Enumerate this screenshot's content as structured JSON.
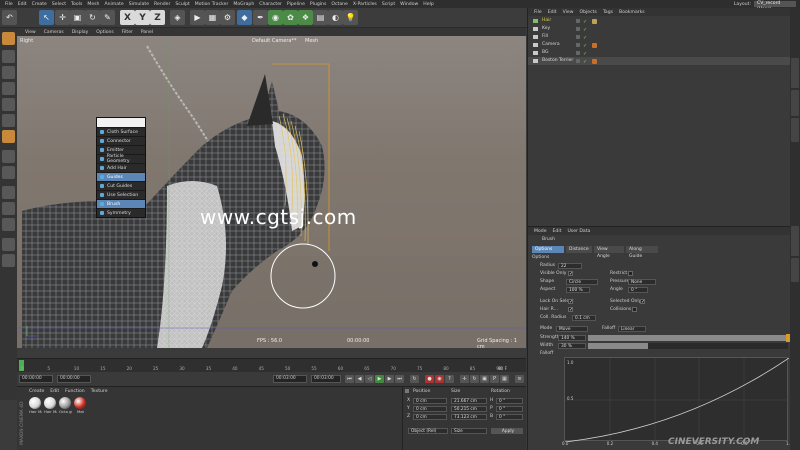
{
  "menubar": {
    "items": [
      "File",
      "Edit",
      "Create",
      "Select",
      "Tools",
      "Mesh",
      "Animate",
      "Simulate",
      "Render",
      "Sculpt",
      "Motion Tracker",
      "MoGraph",
      "Character",
      "Pipeline",
      "Plugins",
      "Octane",
      "X-Particles",
      "Script",
      "Window",
      "Help"
    ],
    "layout_label": "Layout:",
    "layout_value": "CV_record (User)"
  },
  "toolbar": {
    "axis_x": "X",
    "axis_y": "Y",
    "axis_z": "Z"
  },
  "viewport": {
    "menu": [
      "View",
      "Cameras",
      "Display",
      "Options",
      "Filter",
      "Panel"
    ],
    "view_name": "Right",
    "camera": "Default Camera**",
    "mesh_label": "Mesh",
    "fps": "FPS : 56.0",
    "frame": "00:00:00",
    "grid_spacing": "Grid Spacing : 1 cm"
  },
  "hair_menu": {
    "items": [
      {
        "label": "Cloth Surface",
        "highlighted": false
      },
      {
        "label": "Connector",
        "highlighted": false
      },
      {
        "label": "Emitter",
        "highlighted": false
      },
      {
        "label": "Particle Geometry",
        "highlighted": false
      },
      {
        "label": "Add Hair",
        "highlighted": false
      },
      {
        "label": "Guides",
        "highlighted": true
      },
      {
        "label": "Cut Guides",
        "highlighted": false
      },
      {
        "label": "Use Selection",
        "highlighted": false
      },
      {
        "label": "Brush",
        "highlighted": true
      },
      {
        "label": "Symmetry",
        "highlighted": false
      }
    ]
  },
  "timeline": {
    "ticks": [
      "0",
      "5",
      "10",
      "15",
      "20",
      "25",
      "30",
      "35",
      "40",
      "45",
      "50",
      "55",
      "60",
      "65",
      "70",
      "75",
      "80",
      "85",
      "90"
    ],
    "end_frame": "90 F",
    "current": "0",
    "start_time": "00:00:00",
    "current_time": "00:00:00",
    "preview_time": "00:03:00",
    "end_time": "00:03:00"
  },
  "materials": {
    "menu": [
      "Create",
      "Edit",
      "Function",
      "Texture"
    ],
    "items": [
      "Hair Ma",
      "Hair Ma",
      "Octa gl...",
      "Mat"
    ],
    "brand": "MAXON CINEMA 4D"
  },
  "coordinates": {
    "headers": [
      "Position",
      "Size",
      "Rotation"
    ],
    "rows": [
      {
        "axis": "X",
        "pos": "0 cm",
        "size": "21.667 cm",
        "rot_axis": "H",
        "rot": "0 °"
      },
      {
        "axis": "Y",
        "pos": "0 cm",
        "size": "50.215 cm",
        "rot_axis": "P",
        "rot": "0 °"
      },
      {
        "axis": "Z",
        "pos": "0 cm",
        "size": "73.123 cm",
        "rot_axis": "B",
        "rot": "0 °"
      }
    ],
    "mode": "Object (Rel)",
    "size_mode": "Size",
    "apply": "Apply"
  },
  "objects": {
    "menu": [
      "File",
      "Edit",
      "View",
      "Objects",
      "Tags",
      "Bookmarks"
    ],
    "rows": [
      {
        "name": "Hair",
        "color": "#e8d64a",
        "selected": false
      },
      {
        "name": "Key",
        "color": "#d8d8d8",
        "selected": false
      },
      {
        "name": "Fill",
        "color": "#d8d8d8",
        "selected": false
      },
      {
        "name": "Camera",
        "color": "#d8d8d8",
        "selected": false
      },
      {
        "name": "BG",
        "color": "#d8d8d8",
        "selected": false
      },
      {
        "name": "Boston Terrier",
        "color": "#d8d8d8",
        "selected": true
      }
    ]
  },
  "attributes": {
    "menu": [
      "Mode",
      "Edit",
      "User Data"
    ],
    "tool_name": "Brush",
    "tabs": [
      {
        "label": "Options",
        "active": true
      },
      {
        "label": "Distance",
        "active": false
      },
      {
        "label": "View Angle",
        "active": false
      },
      {
        "label": "Along Guide",
        "active": false
      }
    ],
    "section": "Options",
    "radius_label": "Radius",
    "radius_value": "22",
    "visible_only_label": "Visible Only",
    "restrict_label": "Restrict",
    "shape_label": "Shape",
    "shape_value": "Circle",
    "pressure_label": "Pressure",
    "pressure_value": "None",
    "aspect_label": "Aspect",
    "aspect_value": "100 %",
    "angle_label": "Angle",
    "angle_value": "0 °",
    "lock_on_select_label": "Lock On Select",
    "selected_only_label": "Selected Only",
    "hair_r_label": "Hair R...",
    "collisions_label": "Collisions",
    "coll_radius_label": "Coll. Radius",
    "coll_radius_value": "0.1 cm",
    "mode_label": "Mode",
    "mode_value": "Move",
    "falloff_label": "Falloff",
    "falloff_value": "Linear",
    "strength_label": "Strength",
    "strength_value": "140 %",
    "strength_level": 1.0,
    "width_label": "Width",
    "width_value": "30 %",
    "width_level": 0.3,
    "graph_label": "Falloff",
    "graph_y_ticks": [
      "1.0",
      "0.5"
    ],
    "graph_x_ticks": [
      "0.0",
      "0.2",
      "0.4",
      "0.6",
      "0.8",
      "1.0"
    ]
  },
  "watermark": "www.cgtsj.com",
  "watermark2": "CINEVERSITY.COM"
}
